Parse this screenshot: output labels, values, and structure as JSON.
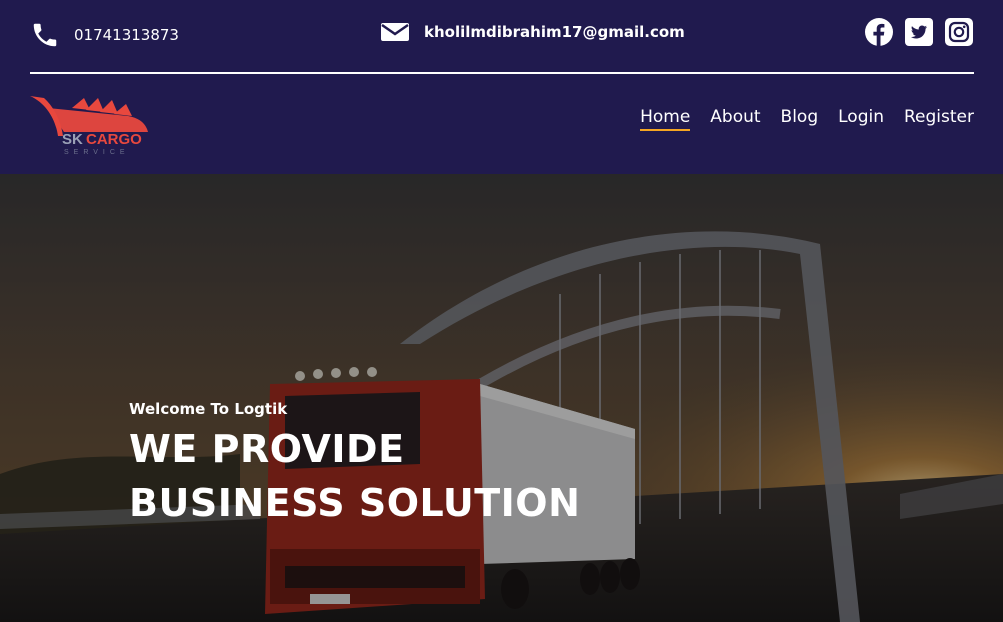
{
  "contact": {
    "phone": "01741313873",
    "email": "kholilmdibrahim17@gmail.com"
  },
  "social": {
    "icons": [
      "facebook-icon",
      "twitter-icon",
      "instagram-icon"
    ]
  },
  "logo": {
    "name_sk": "SK",
    "name_cargo": "CARGO",
    "tagline": "SERVICE"
  },
  "nav": {
    "items": [
      "Home",
      "About",
      "Blog",
      "Login",
      "Register"
    ],
    "active": "Home"
  },
  "hero": {
    "welcome": "Welcome To Logtik",
    "line1": "WE PROVIDE",
    "line2": "BUSINESS SOLUTION"
  },
  "colors": {
    "header_bg": "#201a4e",
    "accent": "#f5a623",
    "logo_red": "#e8483e"
  }
}
